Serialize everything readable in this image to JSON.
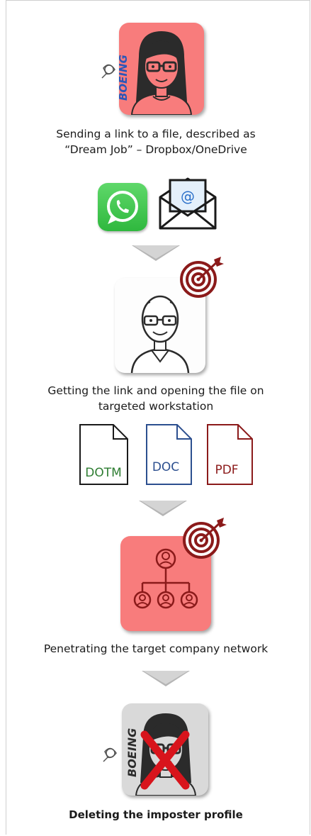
{
  "steps": [
    {
      "caption_line1": "Sending a link to a file, described as",
      "caption_line2": "“Dream Job” – Dropbox/OneDrive"
    },
    {
      "caption_line1": "Getting the link and opening the file on",
      "caption_line2": "targeted workstation"
    },
    {
      "caption_line1": "Penetrating the target company network"
    },
    {
      "caption_line1": "Deleting the imposter profile"
    }
  ],
  "branding": {
    "company_text": "BOEING"
  },
  "files": {
    "dotm": "DOTM",
    "doc": "DOC",
    "pdf": "PDF"
  },
  "email_symbol": "@",
  "colors": {
    "tile_red": "#f87c7c",
    "tile_gray": "#d9d9d9",
    "tile_white": "#ffffff",
    "whatsapp_green": "#3ec94b",
    "target_red": "#8b1a1a",
    "boeing_blue": "#2a56b8",
    "cross_red": "#d8141c",
    "dotm_green": "#2e7d32",
    "doc_blue": "#2c4f8f",
    "pdf_red": "#8b1a1a"
  }
}
